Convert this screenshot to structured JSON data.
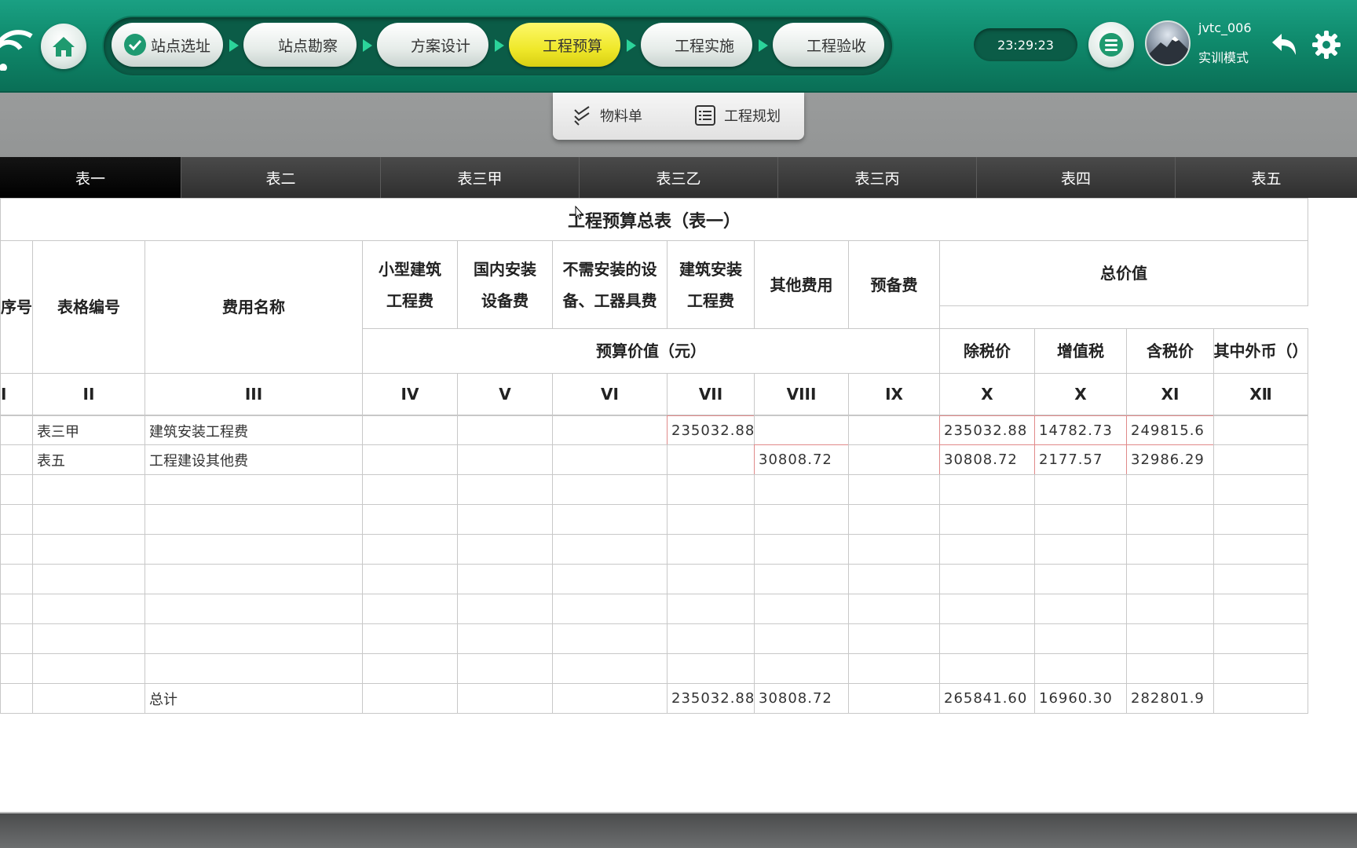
{
  "header": {
    "steps": [
      {
        "label": "站点选址",
        "done": true
      },
      {
        "label": "站点勘察",
        "done": false
      },
      {
        "label": "方案设计",
        "done": false
      },
      {
        "label": "工程预算",
        "done": false,
        "active": true
      },
      {
        "label": "工程实施",
        "done": false
      },
      {
        "label": "工程验收",
        "done": false
      }
    ],
    "clock": "23:29:23",
    "user_name": "jvtc_006",
    "user_mode": "实训模式"
  },
  "toolbar": {
    "bom_label": "物料单",
    "plan_label": "工程规划"
  },
  "tabs": [
    "表一",
    "表二",
    "表三甲",
    "表三乙",
    "表三丙",
    "表四",
    "表五"
  ],
  "sheet": {
    "title": "工程预算总表（表一）",
    "headers": {
      "seq": "序号",
      "form_no": "表格编号",
      "fee_name": "费用名称",
      "small_build_1": "小型建筑",
      "small_build_2": "工程费",
      "domestic_1": "国内安装",
      "domestic_2": "设备费",
      "no_install_1": "不需安装的设",
      "no_install_2": "备、工器具费",
      "build_install_1": "建筑安装",
      "build_install_2": "工程费",
      "other_fee": "其他费用",
      "reserve_fee": "预备费",
      "total_value": "总价值",
      "budget_value": "预算价值（元）",
      "ex_tax": "除税价",
      "vat": "增值税",
      "incl_tax": "含税价",
      "foreign": "其中外币（）"
    },
    "roman": [
      "I",
      "II",
      "III",
      "IV",
      "V",
      "VI",
      "VII",
      "VIII",
      "IX",
      "X",
      "X",
      "XI",
      "XⅡ"
    ],
    "rows": [
      {
        "form": "表三甲",
        "name": "建筑安装工程费",
        "vii": "235032.88",
        "viii": "",
        "x": "235032.88",
        "vat": "14782.73",
        "xi": "249815.6"
      },
      {
        "form": "表五",
        "name": "工程建设其他费",
        "vii": "",
        "viii": "30808.72",
        "x": "30808.72",
        "vat": "2177.57",
        "xi": "32986.29"
      }
    ],
    "total": {
      "name": "总计",
      "vii": "235032.88",
      "viii": "30808.72",
      "x": "265841.60",
      "vat": "16960.30",
      "xi": "282801.9"
    }
  }
}
